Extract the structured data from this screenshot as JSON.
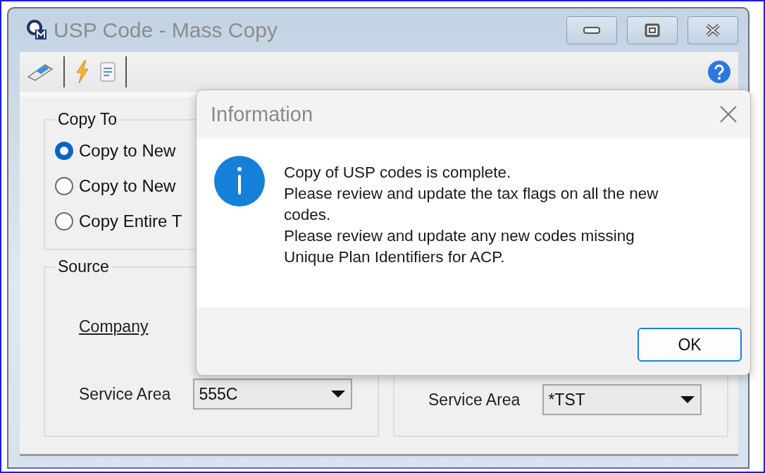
{
  "window": {
    "title": "USP Code - Mass Copy"
  },
  "copy_to": {
    "title": "Copy To",
    "options": [
      {
        "label": "Copy to New",
        "selected": true
      },
      {
        "label": "Copy to New",
        "selected": false
      },
      {
        "label": "Copy Entire T",
        "selected": false
      }
    ]
  },
  "source": {
    "title": "Source",
    "company_label": "Company",
    "service_area": {
      "label": "Service Area",
      "value": "555C"
    }
  },
  "destination": {
    "service_area": {
      "label": "Service Area",
      "value": "*TST"
    }
  },
  "dialog": {
    "title": "Information",
    "message_lines": [
      "Copy of USP codes is complete.",
      "Please review and update the tax flags on all the new",
      "codes.",
      "Please review and update any new codes missing",
      "Unique Plan Identifiers for ACP."
    ],
    "buttons": [
      "OK"
    ]
  }
}
